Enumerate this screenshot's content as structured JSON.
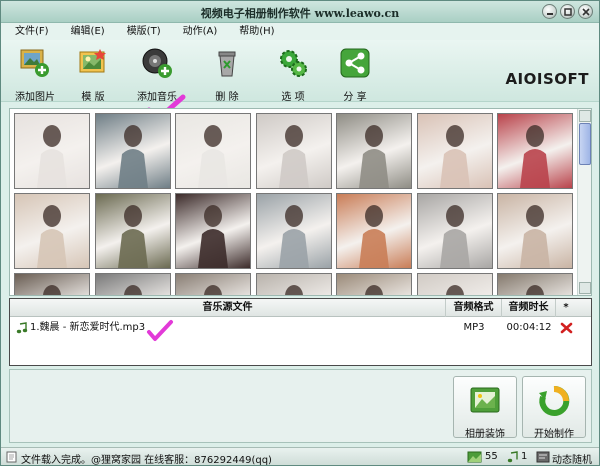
{
  "window": {
    "title": "视频电子相册制作软件 www.leawo.cn"
  },
  "menu": [
    {
      "label": "文件(F)"
    },
    {
      "label": "编辑(E)"
    },
    {
      "label": "模版(T)"
    },
    {
      "label": "动作(A)"
    },
    {
      "label": "帮助(H)"
    }
  ],
  "toolbar": {
    "add_photo": "添加图片",
    "template": "模 版",
    "add_music": "添加音乐",
    "delete": "删 除",
    "options": "选 项",
    "share": "分 享",
    "logo": "AIOISOFT"
  },
  "thumbnails": {
    "count_visible": 21,
    "colors": [
      "#e7e2df",
      "#6f7e86",
      "#e9e7e3",
      "#cfcac6",
      "#8f8d85",
      "#d9c2b6",
      "#b9434b",
      "#d6c5b6",
      "#6b6a51",
      "#3c2b2a",
      "#9aa2a7",
      "#c97d57",
      "#a8a6a4",
      "#c9b4a4",
      "#6a5e54",
      "#7a7a7a",
      "#8a7f75",
      "#b9b3ac",
      "#9b8b7a",
      "#d1cbc5",
      "#857a6e"
    ]
  },
  "music": {
    "headers": {
      "file": "音乐源文件",
      "format": "音频格式",
      "duration": "音频时长",
      "star": "*"
    },
    "rows": [
      {
        "name": "1.魏晨 - 新恋爱时代.mp3",
        "format": "MP3",
        "duration": "00:04:12"
      }
    ]
  },
  "buttons": {
    "decorate": "相册装饰",
    "start": "开始制作"
  },
  "status": {
    "message": "文件载入完成。@狸窝家园 在线客服：876292449(qq)",
    "photo_count": "55",
    "music_count": "1",
    "mode": "动态随机"
  },
  "colors": {
    "accent_green": "#3a9b2f",
    "delete_red": "#d22020",
    "check_magenta": "#e23ad8"
  }
}
